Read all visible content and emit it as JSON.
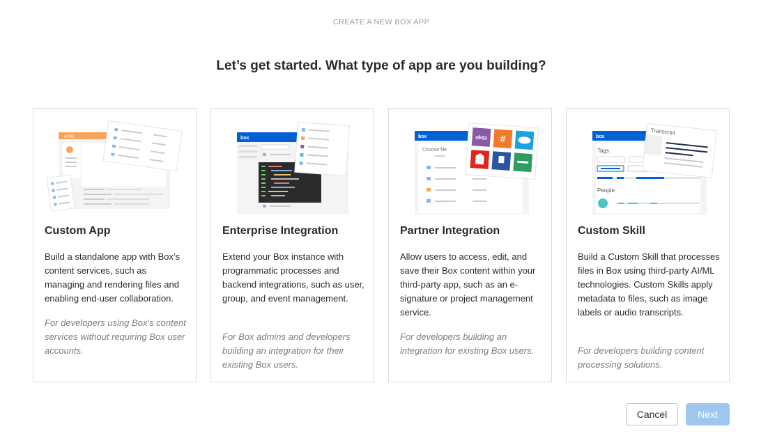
{
  "header": {
    "step_label": "CREATE A NEW BOX APP",
    "title": "Let’s get started. What type of app are you building?"
  },
  "cards": [
    {
      "title": "Custom App",
      "description": "Build a standalone app with Box’s content services, such as managing and rendering files and enabling end-user collaboration.",
      "audience": "For developers using Box’s content services without requiring Box user accounts.",
      "illustration": {
        "brand_label": "ACME",
        "icon": "custom-app-illustration"
      }
    },
    {
      "title": "Enterprise Integration",
      "description": "Extend your Box instance with programmatic processes and backend integrations, such as user, group, and event management.",
      "audience": "For Box admins and developers building an integration for their existing Box users.",
      "illustration": {
        "brand_label": "box",
        "icon": "enterprise-integration-illustration"
      }
    },
    {
      "title": "Partner Integration",
      "description": "Allow users to access, edit, and save their Box content within your third-party app, such as an e-signature or project management service.",
      "audience": "For developers building an integration for existing Box users.",
      "illustration": {
        "brand_label": "box",
        "file_picker_label": "Choose file",
        "partner_labels": [
          "okta",
          "#",
          "Adobe",
          "DocuSign",
          "Salesforce",
          "Smartsheet"
        ],
        "icon": "partner-integration-illustration"
      }
    },
    {
      "title": "Custom Skill",
      "description": "Build a Custom Skill that processes files in Box using third-party AI/ML technologies. Custom Skills apply metadata to files, such as image labels or audio transcripts.",
      "audience": "For developers building content processing solutions.",
      "illustration": {
        "brand_label": "box",
        "transcript_label": "Transcript",
        "tags_label": "Tags",
        "people_label": "People",
        "icon": "custom-skill-illustration"
      }
    }
  ],
  "footer": {
    "cancel_label": "Cancel",
    "next_label": "Next"
  },
  "colors": {
    "box_blue": "#0061d5",
    "next_disabled": "#9fc6ee",
    "acme_orange": "#f7a35c",
    "okta_purple": "#8a5aa6",
    "slack_orange": "#f07a28",
    "adobe_red": "#e0261b",
    "docusign_blue": "#2c55a0",
    "salesforce_blue": "#1fa0e0",
    "smartsheet_green": "#2e9d63",
    "teal": "#4cc3c3"
  }
}
